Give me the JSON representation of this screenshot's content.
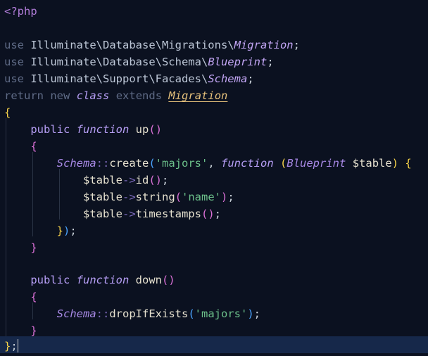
{
  "editor": {
    "language": "php",
    "theme_colors": {
      "background": "#0b1120",
      "current_line": "#16284a",
      "keyword": "#5f6b86",
      "string": "#6cc08a",
      "class": "#c3a6f5",
      "migration_class": "#e5c07b",
      "bracket_1": "#f7d44a",
      "bracket_2": "#da70d6",
      "bracket_3": "#4aa3ff"
    }
  },
  "code": {
    "l1": {
      "open_tag": "<?php"
    },
    "l3": {
      "kw": "use",
      "ns": "Illuminate\\Database\\Migrations\\",
      "cls": "Migration",
      "semi": ";"
    },
    "l4": {
      "kw": "use",
      "ns": "Illuminate\\Database\\Schema\\",
      "cls": "Blueprint",
      "semi": ";"
    },
    "l5": {
      "kw": "use",
      "ns": "Illuminate\\Support\\Facades\\",
      "cls": "Schema",
      "semi": ";"
    },
    "l6": {
      "kw1": "return",
      "kw2": "new",
      "kw3": "class",
      "kw4": "extends",
      "cls": "Migration"
    },
    "l7": {
      "brace": "{"
    },
    "l8": {
      "mod": "public",
      "fn": "function",
      "name": "up",
      "paren_open": "(",
      "paren_close": ")"
    },
    "l9": {
      "brace": "{"
    },
    "l10": {
      "cls": "Schema",
      "op": "::",
      "method": "create",
      "p1": "(",
      "str": "'majors'",
      "comma": ",",
      "fn": "function",
      "p2": "(",
      "type": "Blueprint",
      "var": "$table",
      "p2c": ")",
      "brace": "{"
    },
    "l11": {
      "var": "$table",
      "arrow": "->",
      "method": "id",
      "p": "()",
      "semi": ";"
    },
    "l12": {
      "var": "$table",
      "arrow": "->",
      "method": "string",
      "p1": "(",
      "str": "'name'",
      "p2": ")",
      "semi": ";"
    },
    "l13": {
      "var": "$table",
      "arrow": "->",
      "method": "timestamps",
      "p": "()",
      "semi": ";"
    },
    "l14": {
      "brace": "}",
      "paren": ")",
      "semi": ";"
    },
    "l15": {
      "brace": "}"
    },
    "l17": {
      "mod": "public",
      "fn": "function",
      "name": "down",
      "paren_open": "(",
      "paren_close": ")"
    },
    "l18": {
      "brace": "{"
    },
    "l19": {
      "cls": "Schema",
      "op": "::",
      "method": "dropIfExists",
      "p1": "(",
      "str": "'majors'",
      "p2": ")",
      "semi": ";"
    },
    "l20": {
      "brace": "}"
    },
    "l21": {
      "brace": "}",
      "semi": ";"
    }
  }
}
